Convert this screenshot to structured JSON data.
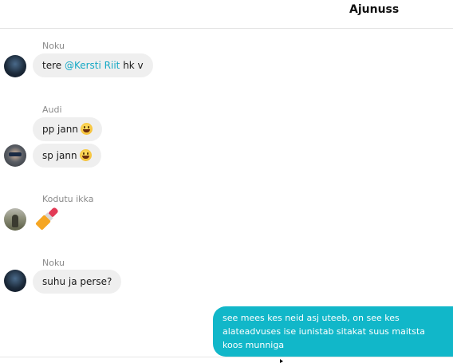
{
  "chat": {
    "title": "Ajunuss"
  },
  "messages": [
    {
      "sender": "Noku",
      "parts": {
        "before": "tere ",
        "mention": "@Kersti Riit",
        "after": " hk v"
      }
    },
    {
      "sender": "Audi",
      "bubbles": [
        "pp jann",
        "sp jann"
      ],
      "emoji": "smile-emoji"
    },
    {
      "sender": "Kodutu ikka",
      "emoji": "lipstick-emoji"
    },
    {
      "sender": "Noku",
      "text": "suhu ja perse?"
    }
  ],
  "own_message": {
    "lines": [
      "see mees kes neid asj uteeb, on see kes",
      "alateadvuses ise iunistab sitakat suus maitsta",
      "koos munniga"
    ]
  },
  "colors": {
    "accent": "#11b7c9",
    "mention": "#17a9c5",
    "bubble_bg": "#efefef"
  }
}
